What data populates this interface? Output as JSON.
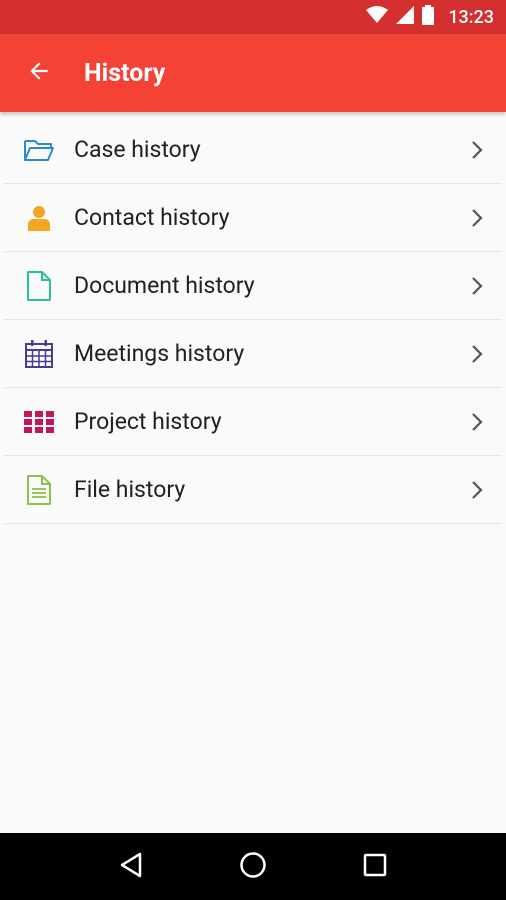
{
  "status_bar": {
    "time": "13:23",
    "icons": [
      "wifi-icon",
      "signal-icon",
      "battery-icon"
    ]
  },
  "app_bar": {
    "title": "History",
    "back_icon": "arrow-back-icon"
  },
  "items": [
    {
      "label": "Case history",
      "icon": "folder-icon",
      "color": "#2a8ad1"
    },
    {
      "label": "Contact history",
      "icon": "person-icon",
      "color": "#f4a623"
    },
    {
      "label": "Document history",
      "icon": "document-icon",
      "color": "#2bbf9a"
    },
    {
      "label": "Meetings history",
      "icon": "calendar-icon",
      "color": "#4b3a8f"
    },
    {
      "label": "Project history",
      "icon": "grid-icon",
      "color": "#c2185b"
    },
    {
      "label": "File history",
      "icon": "file-icon",
      "color": "#8bc34a"
    }
  ],
  "nav_bar": {
    "buttons": [
      "back-triangle-icon",
      "home-circle-icon",
      "recents-square-icon"
    ]
  },
  "colors": {
    "status_bar": "#d32f2f",
    "app_bar": "#f44336",
    "background": "#fafafa"
  }
}
